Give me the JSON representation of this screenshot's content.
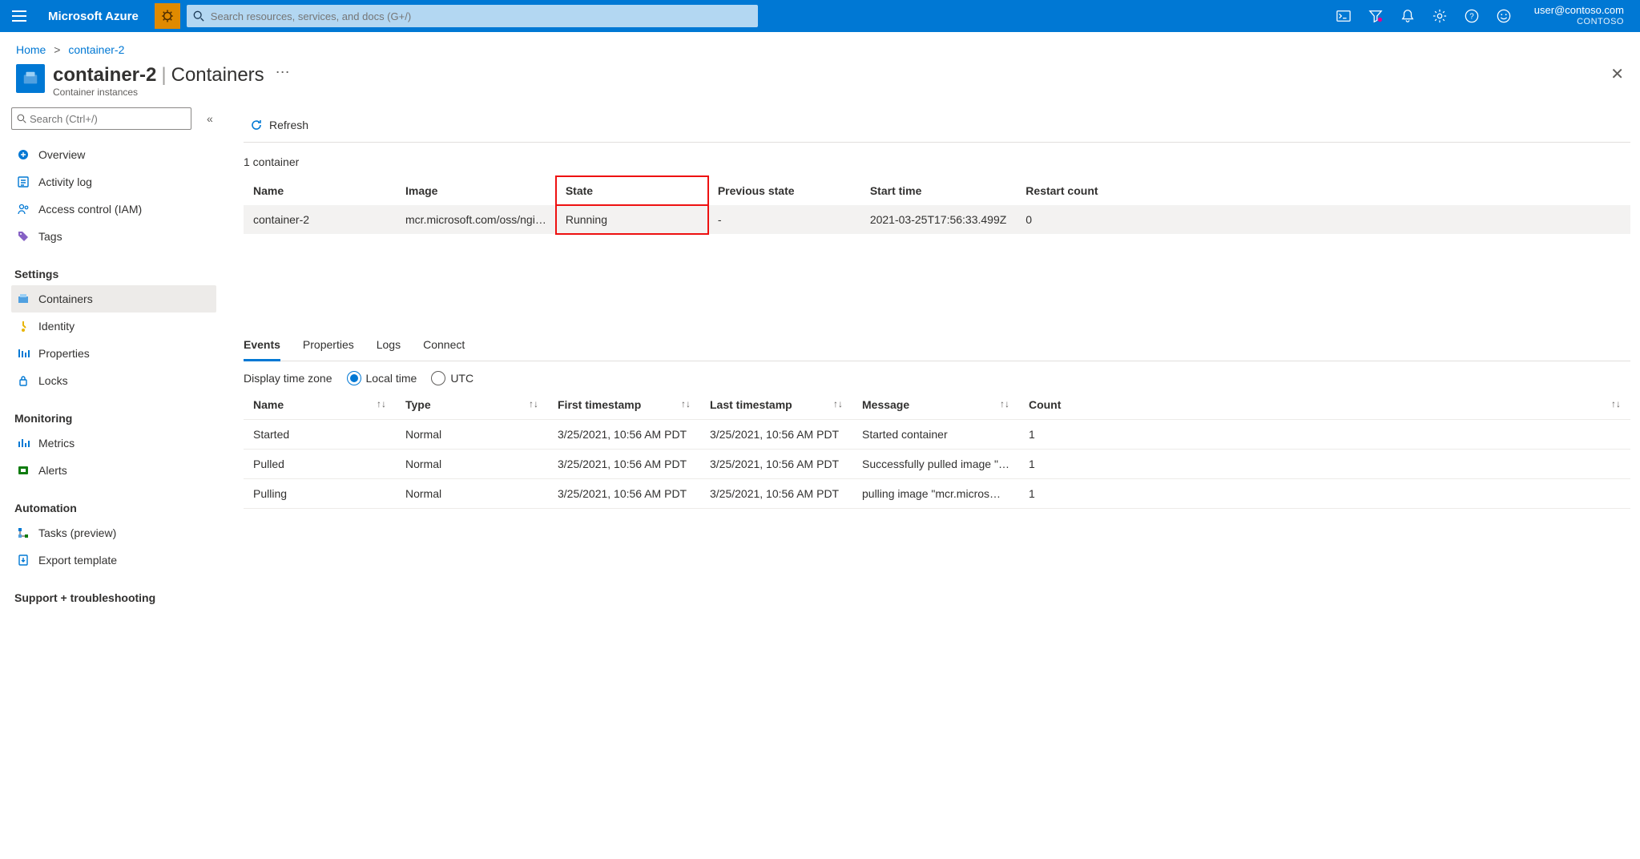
{
  "top": {
    "brand": "Microsoft Azure",
    "search_placeholder": "Search resources, services, and docs (G+/)",
    "user_email": "user@contoso.com",
    "tenant": "CONTOSO"
  },
  "breadcrumb": {
    "home": "Home",
    "current": "container-2"
  },
  "header": {
    "resource_name": "container-2",
    "blade_name": "Containers",
    "subtitle": "Container instances"
  },
  "sidebar": {
    "search_placeholder": "Search (Ctrl+/)",
    "items_top": [
      {
        "label": "Overview"
      },
      {
        "label": "Activity log"
      },
      {
        "label": "Access control (IAM)"
      },
      {
        "label": "Tags"
      }
    ],
    "group_settings_label": "Settings",
    "items_settings": [
      {
        "label": "Containers"
      },
      {
        "label": "Identity"
      },
      {
        "label": "Properties"
      },
      {
        "label": "Locks"
      }
    ],
    "group_monitoring_label": "Monitoring",
    "items_monitoring": [
      {
        "label": "Metrics"
      },
      {
        "label": "Alerts"
      }
    ],
    "group_automation_label": "Automation",
    "items_automation": [
      {
        "label": "Tasks (preview)"
      },
      {
        "label": "Export template"
      }
    ],
    "group_support_label": "Support + troubleshooting"
  },
  "commands": {
    "refresh": "Refresh"
  },
  "container_count_label": "1 container",
  "container_table": {
    "headers": {
      "name": "Name",
      "image": "Image",
      "state": "State",
      "prev": "Previous state",
      "start": "Start time",
      "restart": "Restart count"
    },
    "row": {
      "name": "container-2",
      "image": "mcr.microsoft.com/oss/ngi…",
      "state": "Running",
      "prev": "-",
      "start": "2021-03-25T17:56:33.499Z",
      "restart": "0"
    }
  },
  "tabs": {
    "events": "Events",
    "properties": "Properties",
    "logs": "Logs",
    "connect": "Connect"
  },
  "tz": {
    "label": "Display time zone",
    "local": "Local time",
    "utc": "UTC"
  },
  "events_table": {
    "headers": {
      "name": "Name",
      "type": "Type",
      "first": "First timestamp",
      "last": "Last timestamp",
      "msg": "Message",
      "count": "Count"
    },
    "rows": [
      {
        "name": "Started",
        "type": "Normal",
        "first": "3/25/2021, 10:56 AM PDT",
        "last": "3/25/2021, 10:56 AM PDT",
        "msg": "Started container",
        "count": "1"
      },
      {
        "name": "Pulled",
        "type": "Normal",
        "first": "3/25/2021, 10:56 AM PDT",
        "last": "3/25/2021, 10:56 AM PDT",
        "msg": "Successfully pulled image \"…",
        "count": "1"
      },
      {
        "name": "Pulling",
        "type": "Normal",
        "first": "3/25/2021, 10:56 AM PDT",
        "last": "3/25/2021, 10:56 AM PDT",
        "msg": "pulling image \"mcr.micros…",
        "count": "1"
      }
    ]
  }
}
